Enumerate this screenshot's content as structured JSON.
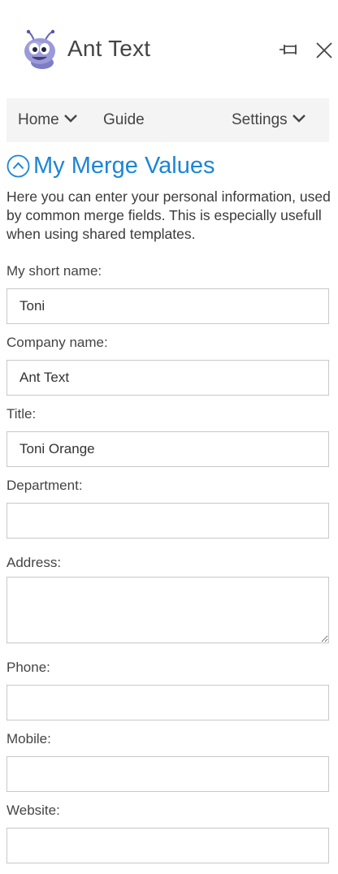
{
  "app": {
    "title": "Ant Text",
    "logo_icon": "ant-mascot-icon",
    "pin_icon": "pin-icon",
    "close_icon": "close-icon"
  },
  "nav": {
    "items": [
      {
        "label": "Home",
        "has_dropdown": true
      },
      {
        "label": "Guide",
        "has_dropdown": false
      },
      {
        "label": "Settings",
        "has_dropdown": true
      }
    ]
  },
  "section": {
    "title": "My Merge Values",
    "toggle_icon": "chevron-up-circle-icon",
    "intro": "Here you can enter your personal information, used by common merge fields. This is especially usefull when using shared templates."
  },
  "fields": {
    "short_name": {
      "label": "My short name:",
      "value": "Toni"
    },
    "company": {
      "label": "Company name:",
      "value": "Ant Text"
    },
    "title": {
      "label": "Title:",
      "value": "Toni Orange"
    },
    "department": {
      "label": "Department:",
      "value": ""
    },
    "address": {
      "label": "Address:",
      "value": ""
    },
    "phone": {
      "label": "Phone:",
      "value": ""
    },
    "mobile": {
      "label": "Mobile:",
      "value": ""
    },
    "website": {
      "label": "Website:",
      "value": ""
    }
  },
  "colors": {
    "accent": "#1b86d6",
    "nav_background": "#f4f4f4",
    "field_border": "#c8c8c8"
  }
}
